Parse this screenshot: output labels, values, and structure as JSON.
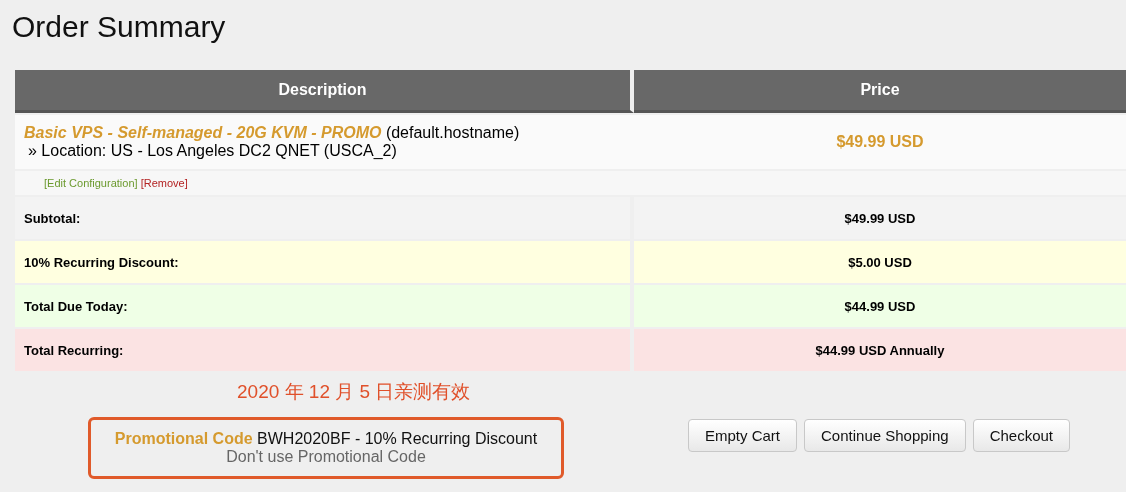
{
  "title": "Order Summary",
  "table": {
    "columns": [
      "Description",
      "Price"
    ],
    "product": {
      "name": "Basic VPS - Self-managed - 20G KVM - PROMO",
      "hostname": "(default.hostname)",
      "option": "» Location: US - Los Angeles DC2 QNET (USCA_2)",
      "price": "$49.99 USD",
      "links": [
        {
          "kind": "edit",
          "label": "[Edit Configuration]"
        },
        {
          "kind": "remove",
          "label": "[Remove]"
        }
      ]
    },
    "summary": [
      {
        "kind": "subtotal",
        "label": "Subtotal:",
        "value": "$49.99 USD"
      },
      {
        "kind": "discount",
        "label": "10% Recurring Discount:",
        "value": "$5.00 USD"
      },
      {
        "kind": "due",
        "label": "Total Due Today:",
        "value": "$44.99 USD"
      },
      {
        "kind": "recurring",
        "label": "Total Recurring:",
        "value": "$44.99 USD Annually"
      }
    ]
  },
  "annotation": "2020 年 12 月 5 日亲测有效",
  "promo": {
    "label": "Promotional Code",
    "code": "BWH2020BF - 10% Recurring Discount",
    "remove_link": "Don't use Promotional Code"
  },
  "buttons": [
    "Empty Cart",
    "Continue Shopping",
    "Checkout"
  ]
}
